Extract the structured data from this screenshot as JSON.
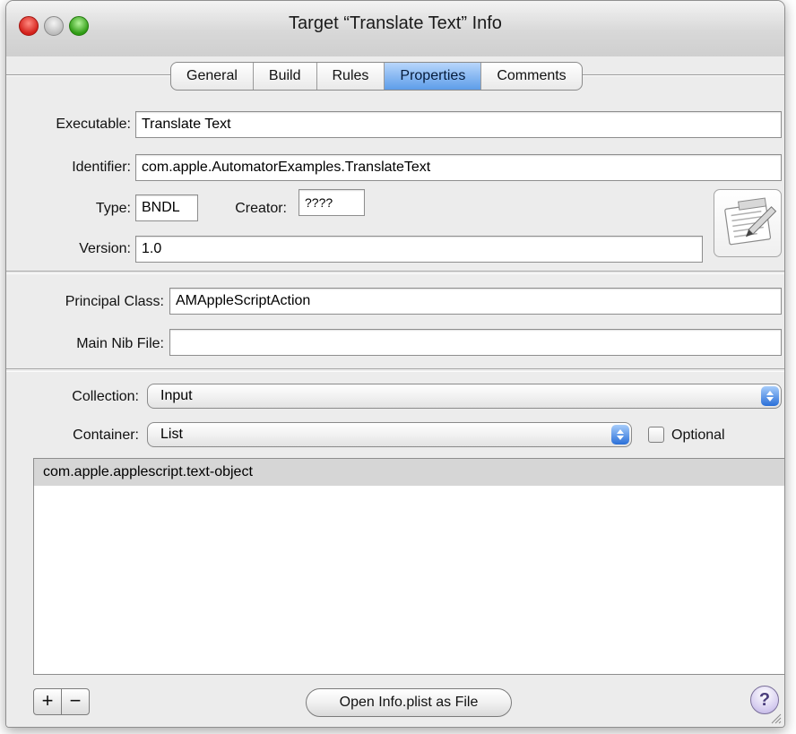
{
  "window": {
    "title": "Target “Translate Text” Info"
  },
  "tabs": [
    {
      "label": "General",
      "active": false
    },
    {
      "label": "Build",
      "active": false
    },
    {
      "label": "Rules",
      "active": false
    },
    {
      "label": "Properties",
      "active": true
    },
    {
      "label": "Comments",
      "active": false
    }
  ],
  "form": {
    "executable_label": "Executable:",
    "executable_value": "Translate Text",
    "identifier_label": "Identifier:",
    "identifier_value": "com.apple.AutomatorExamples.TranslateText",
    "type_label": "Type:",
    "type_value": "BNDL",
    "creator_label": "Creator:",
    "creator_value": "????",
    "version_label": "Version:",
    "version_value": "1.0",
    "principal_class_label": "Principal Class:",
    "principal_class_value": "AMAppleScriptAction",
    "main_nib_label": "Main Nib File:",
    "main_nib_value": "",
    "collection_label": "Collection:",
    "collection_value": "Input",
    "container_label": "Container:",
    "container_value": "List",
    "optional_label": "Optional",
    "optional_checked": false
  },
  "type_list": {
    "items": [
      "com.apple.applescript.text-object"
    ]
  },
  "bottom_bar": {
    "add_label": "+",
    "remove_label": "−",
    "open_plist_label": "Open Info.plist as File",
    "help_label": "?"
  },
  "icons": {
    "document_icon": "bundle-document-icon",
    "resize_grip": "resize-grip-icon"
  },
  "colors": {
    "selected_tab": "#5d9de9",
    "close": "#d3201a",
    "zoom": "#2e9b13",
    "list_selection": "#d6d6d6"
  }
}
